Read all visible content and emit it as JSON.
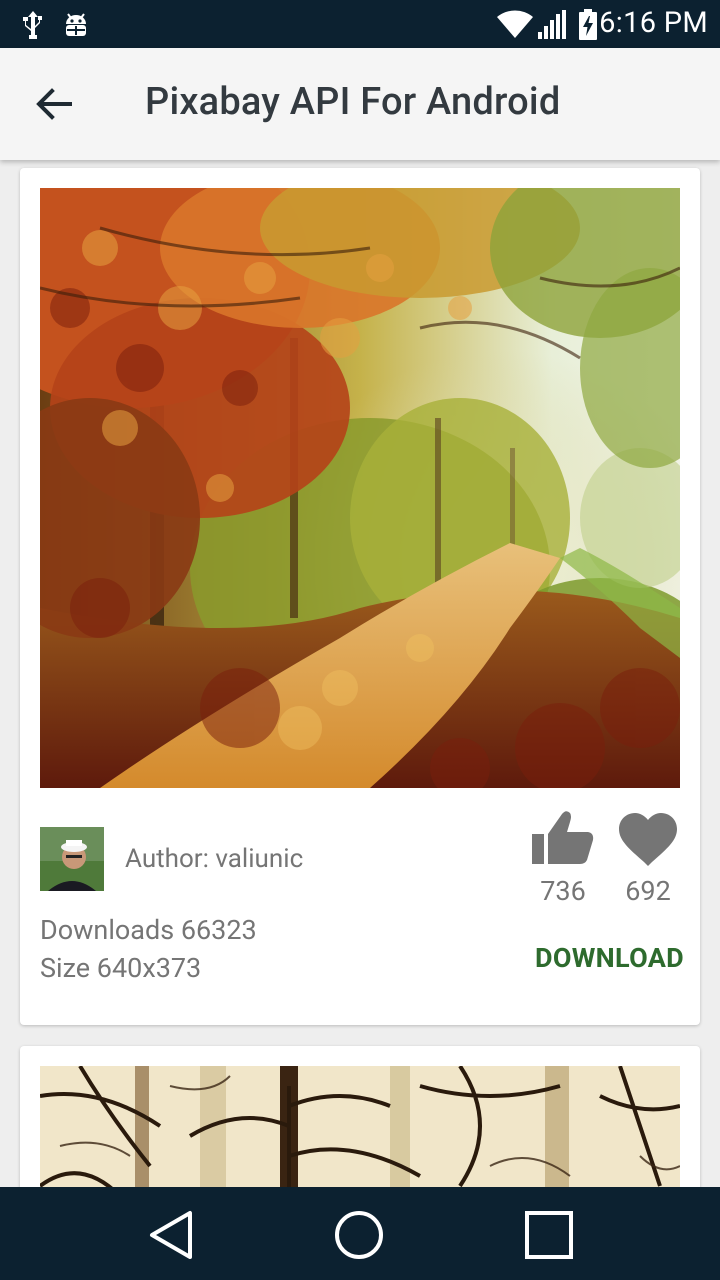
{
  "status_bar": {
    "time": "6:16 PM",
    "icons": [
      "usb-icon",
      "android-debug-icon",
      "wifi-icon",
      "signal-icon",
      "battery-charging-icon"
    ]
  },
  "app_bar": {
    "title": "Pixabay API For Android",
    "back_icon": "arrow-back-icon"
  },
  "cards": [
    {
      "author_label": "Author: valiunic",
      "likes": "736",
      "favorites": "692",
      "downloads_label": "Downloads 66323",
      "size_label": "Size 640x373",
      "download_button": "DOWNLOAD",
      "like_icon": "thumb-up-icon",
      "favorite_icon": "heart-icon"
    }
  ],
  "nav_bar": {
    "icons": [
      "back-triangle-icon",
      "home-circle-icon",
      "recents-square-icon"
    ]
  },
  "colors": {
    "status_bar": "#0c2130",
    "app_bar": "#f5f5f5",
    "accent_green": "#2e6b2e",
    "text_secondary": "#757575",
    "icon_gray": "#757575"
  }
}
